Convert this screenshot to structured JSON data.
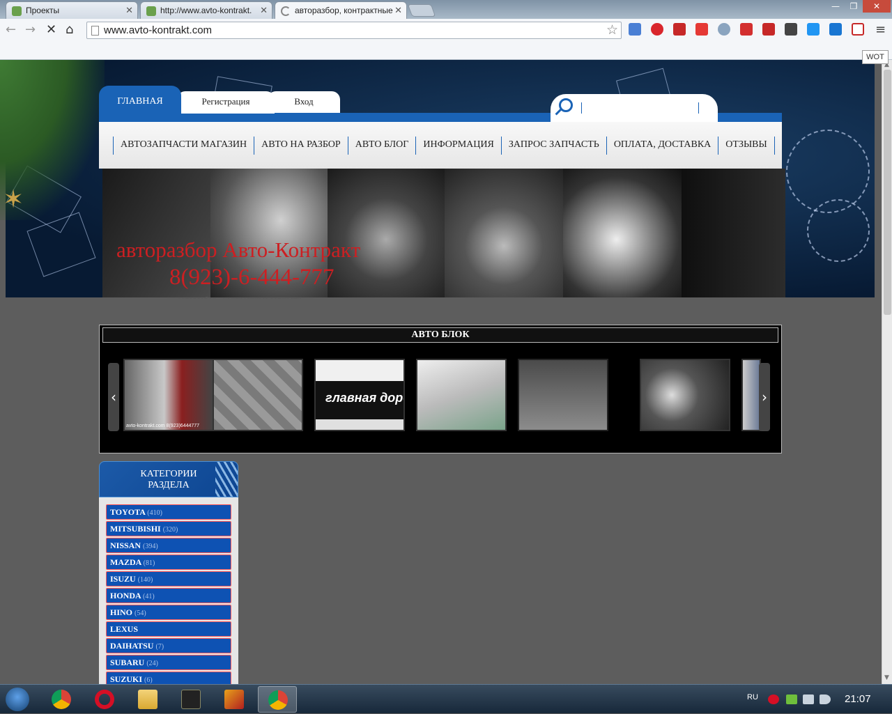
{
  "browser": {
    "tabs": [
      {
        "title": "Проекты"
      },
      {
        "title": "http://www.avto-kontrakt."
      },
      {
        "title": "авторазбор, контрактные"
      }
    ],
    "url": "www.avto-kontrakt.com",
    "wot_label": "WOT",
    "more_label": "»",
    "extensions": [
      "translate-icon",
      "adblock-icon",
      "bookmark-icon",
      "gmail-icon",
      "network-icon",
      "pdf-icon",
      "extension-icon",
      "pocket-icon",
      "d-icon",
      "x-icon",
      "wot-icon"
    ]
  },
  "site": {
    "top_tabs": {
      "home": "ГЛАВНАЯ",
      "register": "Регистрация",
      "login": "Вход"
    },
    "menu": [
      "АВТОЗАПЧАСТИ МАГАЗИН",
      "АВТО НА РАЗБОР",
      "АВТО БЛОГ",
      "ИНФОРМАЦИЯ",
      "ЗАПРОС ЗАПЧАСТЬ",
      "ОПЛАТА, ДОСТАВКА",
      "ОТЗЫВЫ"
    ],
    "brand_name": "авторазбор Авто-Контракт",
    "brand_phone": "8(923)-6-444-777",
    "slogan": "авторазбор , контрактные запчасти",
    "slider_title": "АВТО БЛОК",
    "slider_prev": "‹",
    "slider_next": "›",
    "thumb1_caption": "avto-kontrakt.com 8(923)6444777",
    "thumb3_caption": "главная дорога",
    "categories_title_line1": "КАТЕГОРИИ",
    "categories_title_line2": "РАЗДЕЛА",
    "categories": [
      {
        "name": "TOYOTA",
        "count": "(410)"
      },
      {
        "name": "MITSUBISHI",
        "count": "(320)"
      },
      {
        "name": "NISSAN",
        "count": "(394)"
      },
      {
        "name": "MAZDA",
        "count": "(81)"
      },
      {
        "name": "ISUZU",
        "count": "(140)"
      },
      {
        "name": "HONDA",
        "count": "(41)"
      },
      {
        "name": "HINO",
        "count": "(54)"
      },
      {
        "name": "LEXUS",
        "count": ""
      },
      {
        "name": "DAIHATSU",
        "count": "(7)"
      },
      {
        "name": "SUBARU",
        "count": "(24)"
      },
      {
        "name": "SUZUKI",
        "count": "(6)"
      }
    ],
    "colors": {
      "accent": "#1a63b6",
      "brand_red": "#cc1f22",
      "category_bg": "#0e52b3"
    }
  },
  "taskbar": {
    "lang": "RU",
    "time": "21:07"
  }
}
